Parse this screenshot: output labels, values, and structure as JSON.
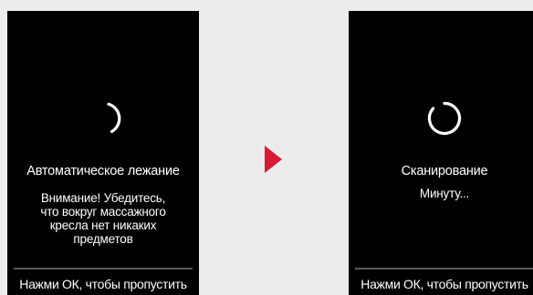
{
  "left_screen": {
    "title": "Автоматическое лежание",
    "warning_lines": [
      "Внимание! Убедитесь,",
      "что вокруг массажного",
      "кресла нет никаких",
      "предметов"
    ],
    "skip_hint": "Нажми ОК, чтобы пропустить",
    "spinner_icon": "loading-spinner-partial"
  },
  "right_screen": {
    "title": "Сканирование",
    "subtitle": "Минуту...",
    "skip_hint": "Нажми ОК, чтобы пропустить",
    "spinner_icon": "loading-spinner-almost-full"
  },
  "arrow": {
    "icon": "play-arrow-right",
    "color": "#d91a35"
  },
  "colors": {
    "background": "#ececec",
    "screen": "#000000",
    "text": "#ffffff",
    "divider": "#5a5a5a"
  }
}
